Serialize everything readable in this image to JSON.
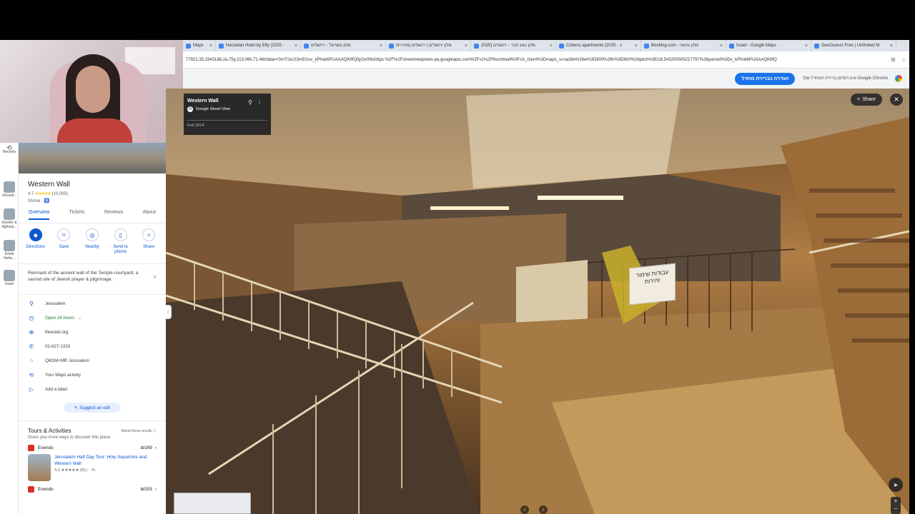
{
  "browser": {
    "tabs": [
      {
        "label": "Maps"
      },
      {
        "label": "Herzelian Hotel by Elfy (2025 -"
      },
      {
        "label": "מלון בשרעל' - ירושלים"
      },
      {
        "label": "מלון ירושלים | ירושלים (מחירים"
      },
      {
        "label": "מלון נוגע הג'ר - ירושלים (2025"
      },
      {
        "label": "Cohens apartments (2025 - כ"
      },
      {
        "label": "Booking.com - מלון עכשיו"
      },
      {
        "label": "Israel - Google Maps"
      },
      {
        "label": "GeoGuessr Free | Unlimited M"
      }
    ],
    "url": "77921,35.2343188,2a,75y,213.06h,71.46t/data=!3m7!1e1!3m5!1sv_kPhok6PUAAAQK6fQfg!2e0!6shttps:%2F%2Fstreetviewpixels-pa.googleapis.com%2Fv1%2Fthumbnail%3Fcb_client%3Dmaps_sv.tactile%26w%3D900%26h%3D600%26pitch%3D18.543200505217797%26panoid%3Dv_kPhok6PUAAAQK6fQ",
    "infobar_text": "אינו דפדפן ברירת המחדל שלך Google Chrome",
    "infobar_button": "הגדרה כברירת מחדל"
  },
  "rail": {
    "items": [
      {
        "label": "Recents"
      },
      {
        "label": "Jerusal..."
      },
      {
        "label": "Gesher & Aghwar..."
      },
      {
        "label": "Emek Hefer..."
      },
      {
        "label": "Israel"
      }
    ]
  },
  "place": {
    "title": "Western Wall",
    "rating": "4.7",
    "stars": "★★★★★",
    "reviews": "(10,095)",
    "type": "Shrine · ♿",
    "tabs": [
      "Overview",
      "Tickets",
      "Reviews",
      "About"
    ],
    "actions": [
      {
        "label": "Directions",
        "icon": "◆"
      },
      {
        "label": "Save",
        "icon": "⌑"
      },
      {
        "label": "Nearby",
        "icon": "◎"
      },
      {
        "label": "Send to phone",
        "icon": "▯"
      },
      {
        "label": "Share",
        "icon": "<"
      }
    ],
    "description": "Remnant of the ancient wall of the Temple courtyard, a sacred site of Jewish prayer & pilgrimage.",
    "info": {
      "address": "Jerusalem",
      "hours": "Open 24 hours",
      "website": "thekotel.org",
      "phone": "02-627-1333",
      "pluscode": "Q6GM+MR Jerusalem",
      "activity": "Your Maps activity",
      "label": "Add a label"
    },
    "suggest": "Suggest an edit",
    "tours": {
      "title": "Tours & Activities",
      "about": "About these results",
      "subtitle": "Gives you more ways to discover this place",
      "items": [
        {
          "vendor": "Evendo",
          "price": "₪169",
          "name": "Jerusalem Half Day Tour: Holy Sepulchre and Western Wall",
          "meta": "4.3 ★★★★★ (81) · 7h"
        },
        {
          "vendor": "Evendo",
          "price": "₪203"
        }
      ]
    }
  },
  "streetview": {
    "title": "Western Wall",
    "source": "Google Street View",
    "date": "Feb 2014",
    "share": "Share",
    "sign": "עבודות שימור זהירות"
  },
  "colors": {
    "accent": "#0b57d0",
    "maps_blue": "#1a73e8",
    "panel_bg": "#ffffff"
  }
}
